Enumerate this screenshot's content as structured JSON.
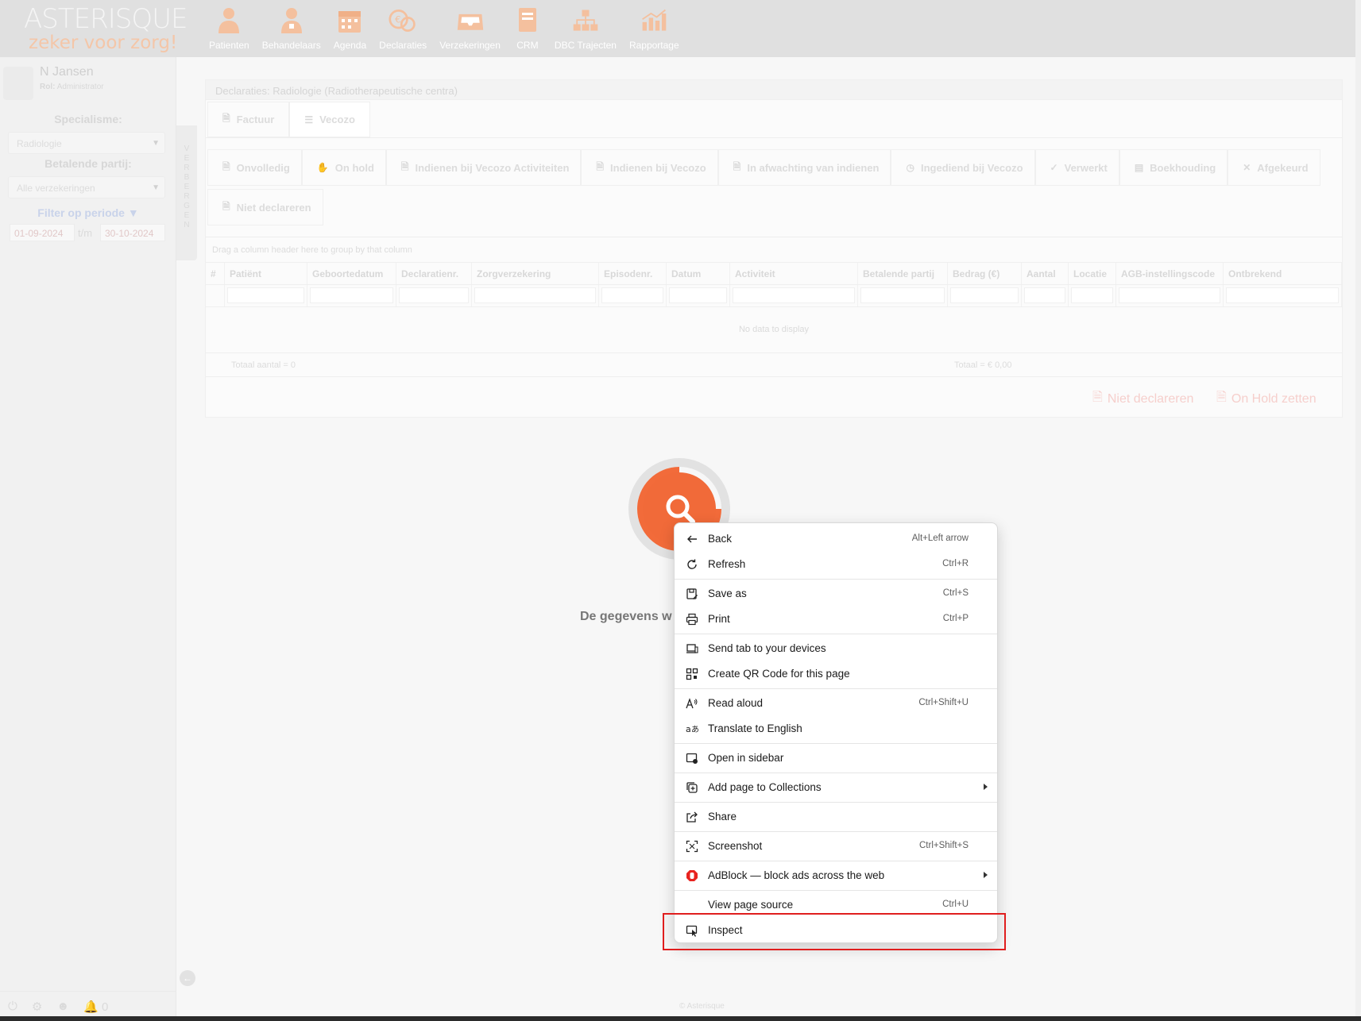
{
  "app": {
    "logo_title": "ASTERISQUE",
    "logo_subtitle": "zeker voor zorg!",
    "nav": [
      {
        "label": "Patienten",
        "icon": "patient-icon"
      },
      {
        "label": "Behandelaars",
        "icon": "doctor-icon"
      },
      {
        "label": "Agenda",
        "icon": "calendar-icon"
      },
      {
        "label": "Declaraties",
        "icon": "euro-coins-icon"
      },
      {
        "label": "Verzekeringen",
        "icon": "inbox-icon"
      },
      {
        "label": "CRM",
        "icon": "book-icon"
      },
      {
        "label": "DBC Trajecten",
        "icon": "hierarchy-icon"
      },
      {
        "label": "Rapportage",
        "icon": "bar-chart-icon"
      }
    ],
    "accent": "#f26b3a"
  },
  "sidebar": {
    "user_name": "N Jansen",
    "role_label": "Rol:",
    "role_value": "Administrator",
    "specialism_label": "Specialisme:",
    "specialism_value": "Radiologie",
    "payer_label": "Betalende partij:",
    "payer_value": "Alle verzekeringen",
    "filter_label": "Filter op periode",
    "date_from": "01-09-2024",
    "date_sep": "t/m",
    "date_to": "30-10-2024",
    "collapse_letters": [
      "V",
      "E",
      "R",
      "B",
      "E",
      "R",
      "G",
      "E",
      "N"
    ],
    "notification_count": "0"
  },
  "main": {
    "breadcrumb": "Declaraties: Radiologie (Radiotherapeutische centra)",
    "tabs": [
      {
        "label": "Factuur"
      },
      {
        "label": "Vecozo"
      }
    ],
    "status_buttons": [
      {
        "label": "Onvolledig",
        "icon": "document-icon"
      },
      {
        "label": "On hold",
        "icon": "hand-icon"
      },
      {
        "label": "Indienen bij Vecozo Activiteiten",
        "icon": "document-icon"
      },
      {
        "label": "Indienen bij Vecozo",
        "icon": "document-icon"
      },
      {
        "label": "In afwachting van indienen",
        "icon": "document-icon"
      },
      {
        "label": "Ingediend bij Vecozo",
        "icon": "clock-icon"
      },
      {
        "label": "Verwerkt",
        "icon": "check-icon"
      },
      {
        "label": "Boekhouding",
        "icon": "books-icon"
      },
      {
        "label": "Afgekeurd",
        "icon": "x-icon"
      },
      {
        "label": "Niet declareren",
        "icon": "document-icon"
      }
    ],
    "group_hint": "Drag a column header here to group by that column",
    "columns": [
      "#",
      "Patiënt",
      "Geboortedatum",
      "Declaratienr.",
      "Zorgverzekering",
      "Episodenr.",
      "Datum",
      "Activiteit",
      "Betalende partij",
      "Bedrag (€)",
      "Aantal",
      "Locatie",
      "AGB-instellingscode",
      "Ontbrekend"
    ],
    "no_data": "No data to display",
    "total_count": "Totaal aantal = 0",
    "total_amount": "Totaal = € 0,00",
    "action_not_declare": "Niet declareren",
    "action_on_hold": "On Hold zetten",
    "loading_text": "De gegevens w",
    "copyright": "© Asterisque"
  },
  "context_menu": {
    "items": [
      {
        "label": "Back",
        "shortcut": "Alt+Left arrow",
        "icon": "back-arrow-icon"
      },
      {
        "label": "Refresh",
        "shortcut": "Ctrl+R",
        "icon": "refresh-icon"
      },
      {
        "label": "Save as",
        "shortcut": "Ctrl+S",
        "icon": "save-as-icon"
      },
      {
        "label": "Print",
        "shortcut": "Ctrl+P",
        "icon": "print-icon"
      },
      {
        "label": "Send tab to your devices",
        "shortcut": "",
        "icon": "send-tab-icon"
      },
      {
        "label": "Create QR Code for this page",
        "shortcut": "",
        "icon": "qr-code-icon"
      },
      {
        "label": "Read aloud",
        "shortcut": "Ctrl+Shift+U",
        "icon": "read-aloud-icon"
      },
      {
        "label": "Translate to English",
        "shortcut": "",
        "icon": "translate-icon"
      },
      {
        "label": "Open in sidebar",
        "shortcut": "",
        "icon": "sidebar-icon"
      },
      {
        "label": "Add page to Collections",
        "shortcut": "",
        "icon": "collections-icon"
      },
      {
        "label": "Share",
        "shortcut": "",
        "icon": "share-icon"
      },
      {
        "label": "Screenshot",
        "shortcut": "Ctrl+Shift+S",
        "icon": "screenshot-icon"
      },
      {
        "label": "AdBlock — block ads across the web",
        "shortcut": "",
        "icon": "adblock-icon"
      },
      {
        "label": "View page source",
        "shortcut": "Ctrl+U",
        "icon": ""
      },
      {
        "label": "Inspect",
        "shortcut": "",
        "icon": "inspect-icon"
      }
    ],
    "highlight_color": "#e01e1e"
  }
}
